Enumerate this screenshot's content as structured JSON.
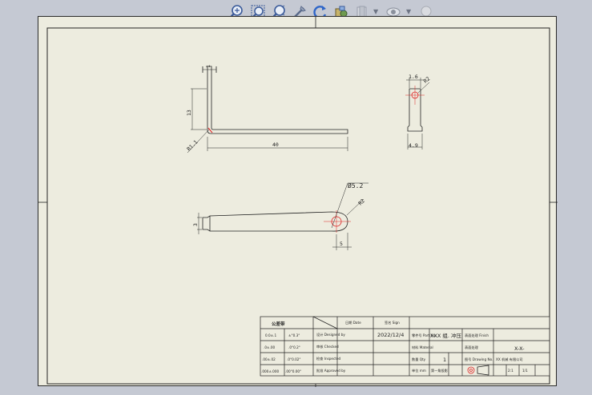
{
  "toolbar": {
    "icons": [
      "zoom-to-fit-icon",
      "zoom-to-area-icon",
      "zoom-in-out-icon",
      "pan-icon",
      "rotate-icon",
      "display-style-icon",
      "section-view-icon",
      "hide-show-icon",
      "appearance-icon"
    ]
  },
  "drawing": {
    "front_view": {
      "height_dim": "13",
      "length_dim": "40",
      "top_dim": "1",
      "radius_dim": "R1.1"
    },
    "side_view": {
      "top_dim": "1.6",
      "radius_dim": "R2",
      "width_dim": "4.9"
    },
    "top_view": {
      "height_dim": "3",
      "hole_dim": "Ø5.2",
      "radius_dim": "R2",
      "offset_dim": "5"
    }
  },
  "title_block": {
    "tolerance_header": "公差带",
    "tolerance_rows": [
      {
        "range": "0.0±.1",
        "tol": "±°0.3°"
      },
      {
        "range": ".0±.00",
        "tol": ".0°0.2°"
      },
      {
        "range": ".00±.02",
        "tol": ".0°0.02°"
      },
      {
        "range": ".000±.000",
        "tol": ".00°0.00°"
      }
    ],
    "role_labels": [
      "设计\nDesigned by",
      "审核\nChecked",
      "检查\nInspected",
      "批准\nApproved by"
    ],
    "date_header": "日期\nDate",
    "sign_header": "签名\nSign",
    "date_value": "2022/12/4",
    "part_name": "XXX 组. 冲压",
    "part_no_label": "零件号\nPart No.",
    "material_label": "材料\nMaterial",
    "finish_label": "表面处理\nFinish",
    "surface_label": "表面处理",
    "quantity_label": "数量\nQty",
    "quantity_value": "1",
    "scale_label": "比例\nScale",
    "scale_value": "2:1",
    "sheet_label": "张 / 张\nSheet",
    "sheet_value": "1/1",
    "drawing_no_label": "图号\nDrawing No.",
    "drawing_no_value": "X-X-",
    "company": "XX 机械 有限公司",
    "units_label": "单位 mm",
    "projection_label": "第一角投影"
  }
}
